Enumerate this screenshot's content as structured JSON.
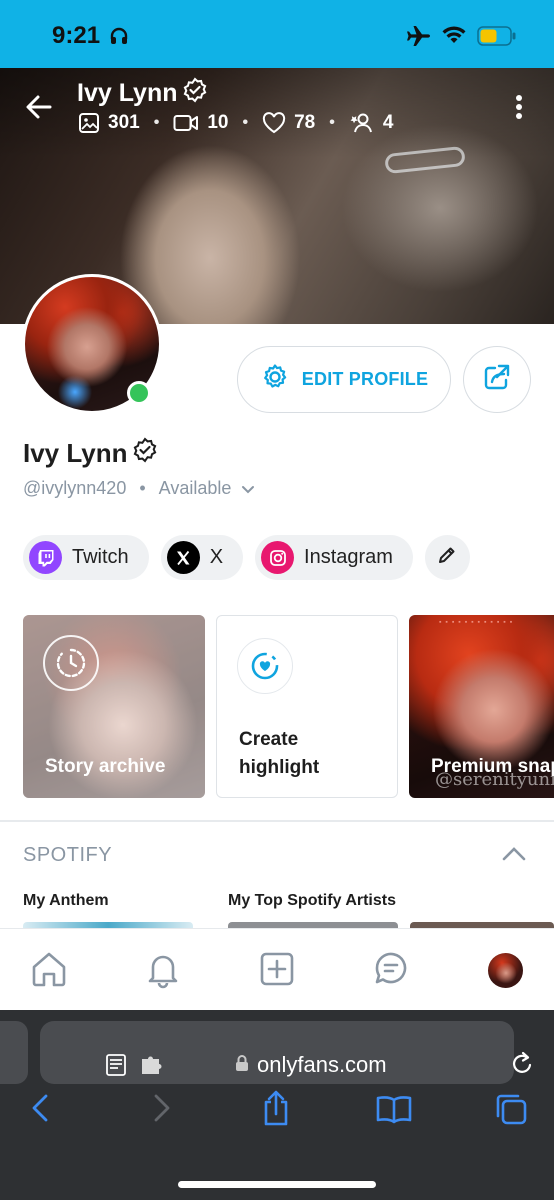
{
  "status_bar": {
    "time": "9:21"
  },
  "profile": {
    "name": "Ivy Lynn",
    "handle": "@ivylynn420",
    "separator": "•",
    "status": "Available",
    "stats": {
      "photos": "301",
      "videos": "10",
      "likes": "78",
      "subscribers": "4"
    },
    "stat_separator": "•"
  },
  "buttons": {
    "edit_profile": "EDIT PROFILE"
  },
  "social_links": [
    {
      "label": "Twitch",
      "icon": "twitch-icon",
      "color": "#9146ff"
    },
    {
      "label": "X",
      "icon": "x-icon",
      "color": "#000000"
    },
    {
      "label": "Instagram",
      "icon": "instagram-icon",
      "color": "#e1306c"
    }
  ],
  "highlights": {
    "archive": "Story archive",
    "create_line1": "Create",
    "create_line2": "highlight",
    "premium": "Premium snap",
    "premium_watermark": "@serenityunity"
  },
  "spotify": {
    "title": "SPOTIFY",
    "items": [
      "My Anthem",
      "My Top Spotify Artists"
    ]
  },
  "browser": {
    "url": "onlyfans.com"
  },
  "colors": {
    "accent": "#00aff0",
    "status_bar": "#10b2e6",
    "online": "#35c45a",
    "muted": "#8a96a3"
  }
}
